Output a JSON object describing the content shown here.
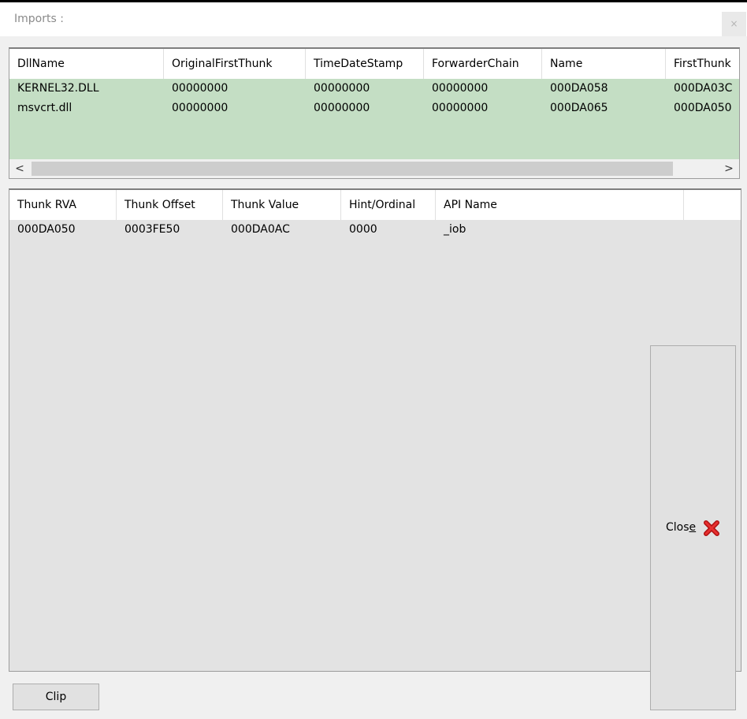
{
  "window": {
    "title": "Imports :",
    "close_glyph": "×"
  },
  "dll_table": {
    "columns": [
      "DllName",
      "OriginalFirstThunk",
      "TimeDateStamp",
      "ForwarderChain",
      "Name",
      "FirstThunk"
    ],
    "rows": [
      [
        "KERNEL32.DLL",
        "00000000",
        "00000000",
        "00000000",
        "000DA058",
        "000DA03C"
      ],
      [
        "msvcrt.dll",
        "00000000",
        "00000000",
        "00000000",
        "000DA065",
        "000DA050"
      ]
    ],
    "selected_row_color": "#c4dec4",
    "scroll_left": "<",
    "scroll_right": ">"
  },
  "thunk_table": {
    "columns": [
      "Thunk RVA",
      "Thunk Offset",
      "Thunk Value",
      "Hint/Ordinal",
      "API Name"
    ],
    "rows": [
      [
        "000DA050",
        "0003FE50",
        "000DA0AC",
        "0000",
        "_iob"
      ]
    ]
  },
  "buttons": {
    "clip": "Clip",
    "close_prefix": "Clos",
    "close_mnemonic": "e",
    "close_icon": "red-x-icon"
  }
}
